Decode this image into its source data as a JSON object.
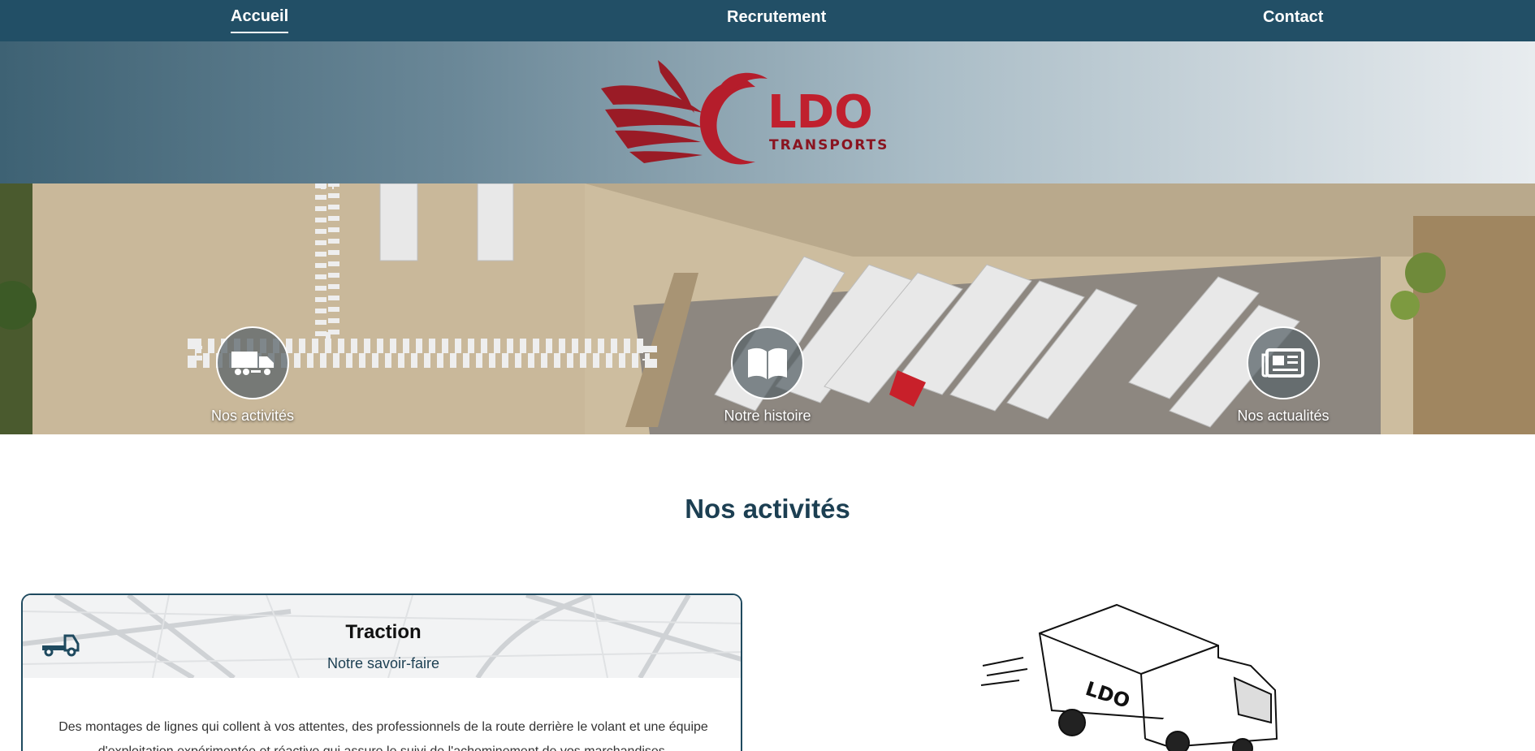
{
  "nav": {
    "items": [
      {
        "label": "Accueil",
        "active": true
      },
      {
        "label": "Recrutement",
        "active": false
      },
      {
        "label": "Contact",
        "active": false
      }
    ]
  },
  "logo": {
    "brand": "LDO",
    "tagline": "TRANSPORTS",
    "colors": {
      "primary": "#c0202e",
      "dark": "#8a1420"
    }
  },
  "hero": {
    "links": [
      {
        "label": "Nos activités",
        "icon": "truck-icon"
      },
      {
        "label": "Notre histoire",
        "icon": "book-icon"
      },
      {
        "label": "Nos actualités",
        "icon": "newspaper-icon"
      }
    ]
  },
  "section": {
    "title": "Nos activités"
  },
  "card": {
    "icon": "tow-truck-icon",
    "title": "Traction",
    "subtitle": "Notre savoir-faire",
    "text": "Des montages de lignes qui collent à vos attentes, des professionnels de la route derrière le volant et une équipe d'exploitation expérimentée et réactive qui assure le suivi de l'acheminement de vos marchandises."
  },
  "illustration": {
    "icon": "truck-sketch-icon",
    "truck_text": "LDO"
  },
  "colors": {
    "nav_bg": "#224f66",
    "heading": "#1c3f52",
    "card_border": "#1f4a5f"
  }
}
